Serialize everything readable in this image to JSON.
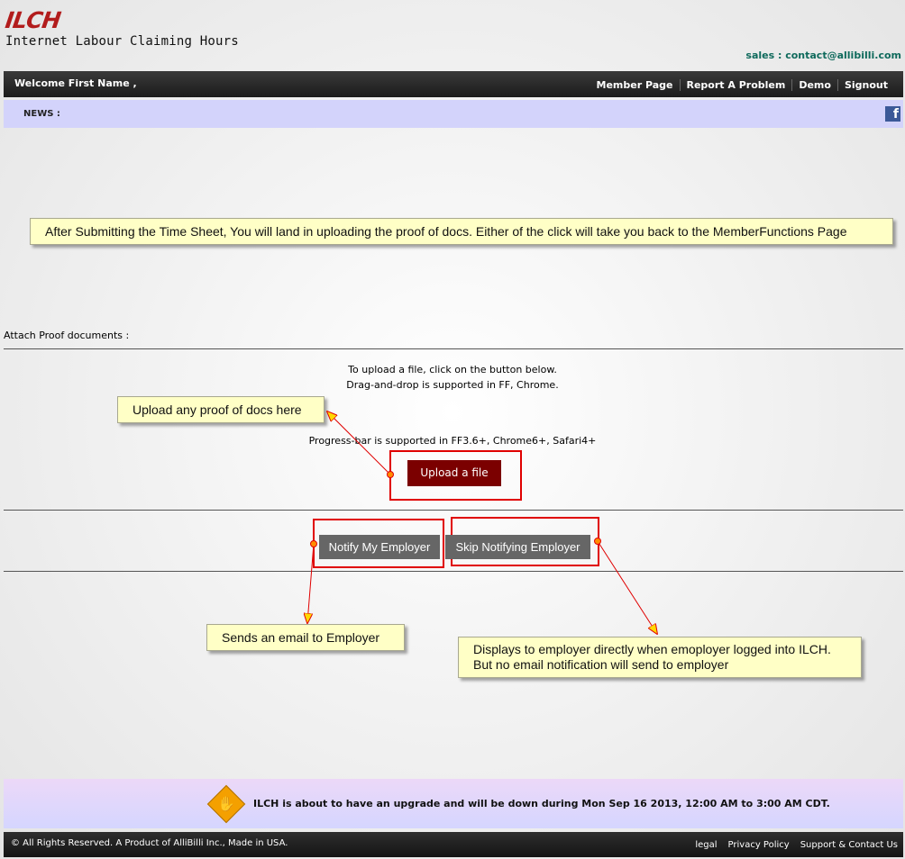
{
  "header": {
    "logo": "ILCH",
    "subtitle": "Internet Labour Claiming Hours",
    "sales": "sales : contact@allibilli.com"
  },
  "topbar": {
    "welcome": "Welcome  First Name ,",
    "menu": [
      "Member Page",
      "Report A Problem",
      "Demo",
      "Signout"
    ]
  },
  "news": {
    "label": "NEWS :",
    "facebook": "f"
  },
  "callouts": {
    "top": "After Submitting the Time Sheet, You will land in uploading the proof of docs. Either of the click will take you back to the MemberFunctions Page",
    "upload": "Upload any proof of docs here",
    "notify": "Sends an email to Employer",
    "skip_line1": "Displays to employer directly when emoployer logged into ILCH.",
    "skip_line2": "But no email notification will send to employer"
  },
  "upload": {
    "section_label": "Attach Proof documents :",
    "instruction1": "To upload a file, click on the button below.",
    "instruction2": "Drag-and-drop is supported in FF, Chrome.",
    "progress_note": "Progress-bar is supported in FF3.6+, Chrome6+, Safari4+",
    "button": "Upload a file"
  },
  "actions": {
    "notify": "Notify My Employer",
    "skip": "Skip Notifying Employer"
  },
  "notice": {
    "text": "ILCH is about to have an upgrade and will be down during Mon Sep 16 2013, 12:00 AM to 3:00 AM CDT."
  },
  "footer": {
    "copyright": "© All Rights Reserved. A Product of AlliBilli Inc., Made in USA.",
    "links": [
      "legal",
      "Privacy Policy",
      "Support & Contact Us"
    ]
  },
  "colors": {
    "brand_red": "#b21c1c",
    "upload_button": "#7b0000",
    "callout_bg": "#ffffc6",
    "annotation_red": "#e00000"
  }
}
